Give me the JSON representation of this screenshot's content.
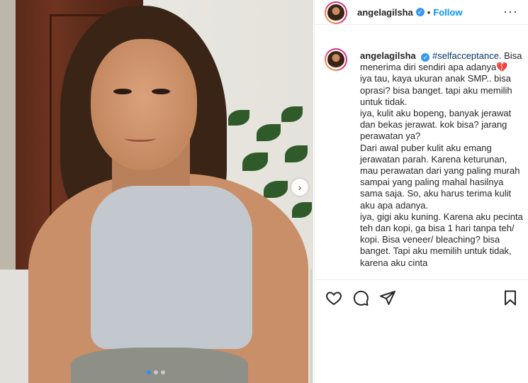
{
  "post": {
    "carousel": {
      "total": 3,
      "active": 1
    }
  },
  "header": {
    "username": "angelagilsha",
    "separator": "•",
    "follow_label": "Follow",
    "more_label": "···"
  },
  "caption": {
    "username": "angelagilsha",
    "hashtag": "#selfacceptance",
    "text_line1": ". Bisa menerima diri sendiri apa adanya",
    "heart": "💔",
    "body": "iya tau, kaya ukuran anak SMP.. bisa oprasi? bisa banget. tapi aku memilih untuk tidak.\niya, kulit aku bopeng, banyak jerawat dan bekas jerawat. kok bisa? jarang perawatan ya?\nDari awal puber kulit aku emang jerawatan parah. Karena keturunan, mau perawatan dari yang paling murah sampai yang paling mahal hasilnya sama saja. So, aku harus terima kulit aku apa adanya.\niya, gigi aku kuning. Karena aku pecinta teh dan kopi, ga bisa 1 hari tanpa teh/ kopi. Bisa veneer/ bleaching? bisa banget. Tapi aku memilih untuk tidak, karena aku cinta"
  },
  "actions": {
    "like_icon": "heart-outline-icon",
    "comment_icon": "comment-bubble-icon",
    "share_icon": "paper-plane-icon",
    "save_icon": "bookmark-icon"
  },
  "colors": {
    "follow": "#0095f6",
    "verified": "#3897f0",
    "hashtag": "#00376b",
    "dot_active": "#2f8ef4"
  }
}
